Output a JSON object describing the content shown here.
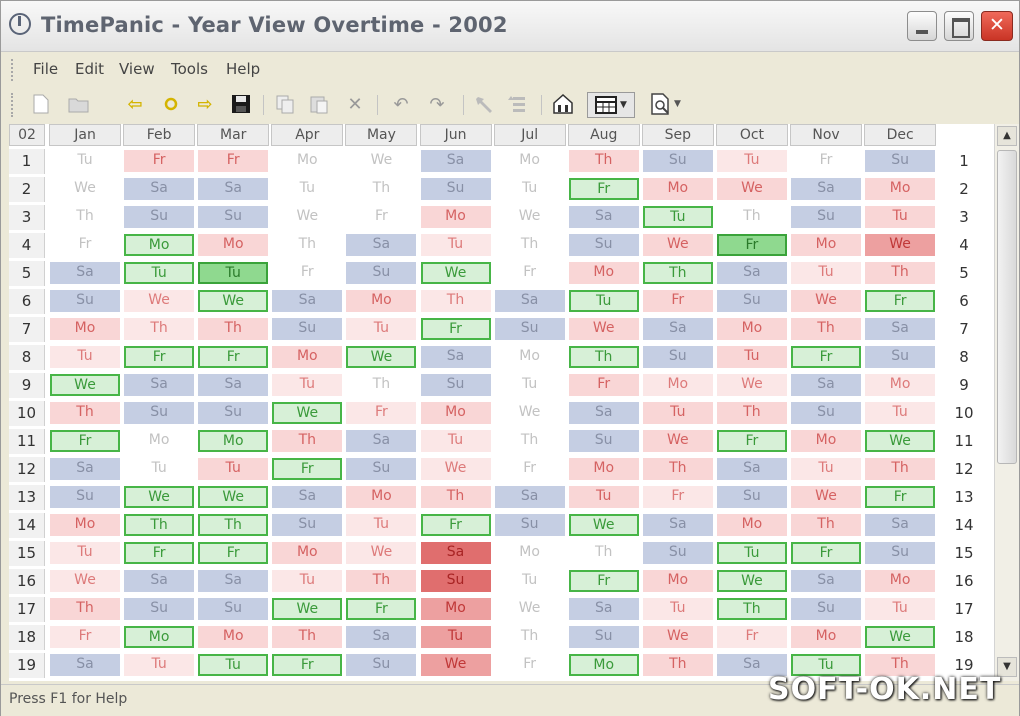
{
  "window": {
    "title": "TimePanic - Year View Overtime - 2002",
    "close_glyph": "✕",
    "icon": "clock-icon"
  },
  "menu": [
    "File",
    "Edit",
    "View",
    "Tools",
    "Help"
  ],
  "toolbar": {
    "icons": [
      "new-document-icon",
      "open-folder-icon",
      "back-arrow-icon",
      "circle-icon",
      "forward-arrow-icon",
      "save-icon",
      "copy-icon",
      "paste-icon",
      "delete-icon",
      "undo-icon",
      "redo-icon",
      "hammer-icon",
      "list-icon",
      "home-icon",
      "grid-view-icon",
      "print-preview-icon"
    ],
    "colors": {
      "arrow": "#d4b400",
      "save": "#1a1a1a"
    }
  },
  "grid": {
    "year_label": "02",
    "months": [
      "Jan",
      "Feb",
      "Mar",
      "Apr",
      "May",
      "Jun",
      "Jul",
      "Aug",
      "Sep",
      "Oct",
      "Nov",
      "Dec"
    ],
    "row_labels": [
      "1",
      "2",
      "3",
      "4",
      "5",
      "6",
      "7",
      "8",
      "9",
      "10",
      "11",
      "12",
      "13",
      "14",
      "15",
      "16",
      "17",
      "18",
      "19"
    ],
    "cells": [
      [
        [
          "Tu",
          "w"
        ],
        [
          "We",
          "w"
        ],
        [
          "Th",
          "w"
        ],
        [
          "Fr",
          "w"
        ],
        [
          "Sa",
          "b"
        ],
        [
          "Su",
          "b"
        ],
        [
          "Mo",
          "p"
        ],
        [
          "Tu",
          "lp"
        ],
        [
          "We",
          "g"
        ],
        [
          "Th",
          "p"
        ],
        [
          "Fr",
          "g"
        ],
        [
          "Sa",
          "b"
        ],
        [
          "Su",
          "b"
        ],
        [
          "Mo",
          "p"
        ],
        [
          "Tu",
          "lp"
        ],
        [
          "We",
          "lp"
        ],
        [
          "Th",
          "p"
        ],
        [
          "Fr",
          "lp"
        ],
        [
          "Sa",
          "b"
        ]
      ],
      [
        [
          "Fr",
          "p"
        ],
        [
          "Sa",
          "b"
        ],
        [
          "Su",
          "b"
        ],
        [
          "Mo",
          "g"
        ],
        [
          "Tu",
          "g"
        ],
        [
          "We",
          "lp"
        ],
        [
          "Th",
          "lp"
        ],
        [
          "Fr",
          "g"
        ],
        [
          "Sa",
          "b"
        ],
        [
          "Su",
          "b"
        ],
        [
          "Mo",
          "w"
        ],
        [
          "Tu",
          "w"
        ],
        [
          "We",
          "g"
        ],
        [
          "Th",
          "g"
        ],
        [
          "Fr",
          "g"
        ],
        [
          "Sa",
          "b"
        ],
        [
          "Su",
          "b"
        ],
        [
          "Mo",
          "g"
        ],
        [
          "Tu",
          "lp"
        ]
      ],
      [
        [
          "Fr",
          "p"
        ],
        [
          "Sa",
          "b"
        ],
        [
          "Su",
          "b"
        ],
        [
          "Mo",
          "p"
        ],
        [
          "Tu",
          "gf"
        ],
        [
          "We",
          "g"
        ],
        [
          "Th",
          "p"
        ],
        [
          "Fr",
          "g"
        ],
        [
          "Sa",
          "b"
        ],
        [
          "Su",
          "b"
        ],
        [
          "Mo",
          "g"
        ],
        [
          "Tu",
          "p"
        ],
        [
          "We",
          "g"
        ],
        [
          "Th",
          "g"
        ],
        [
          "Fr",
          "g"
        ],
        [
          "Sa",
          "b"
        ],
        [
          "Su",
          "b"
        ],
        [
          "Mo",
          "p"
        ],
        [
          "Tu",
          "g"
        ]
      ],
      [
        [
          "Mo",
          "w"
        ],
        [
          "Tu",
          "w"
        ],
        [
          "We",
          "w"
        ],
        [
          "Th",
          "w"
        ],
        [
          "Fr",
          "w"
        ],
        [
          "Sa",
          "b"
        ],
        [
          "Su",
          "b"
        ],
        [
          "Mo",
          "p"
        ],
        [
          "Tu",
          "lp"
        ],
        [
          "We",
          "g"
        ],
        [
          "Th",
          "p"
        ],
        [
          "Fr",
          "g"
        ],
        [
          "Sa",
          "b"
        ],
        [
          "Su",
          "b"
        ],
        [
          "Mo",
          "p"
        ],
        [
          "Tu",
          "lp"
        ],
        [
          "We",
          "g"
        ],
        [
          "Th",
          "p"
        ],
        [
          "Fr",
          "g"
        ]
      ],
      [
        [
          "We",
          "w"
        ],
        [
          "Th",
          "w"
        ],
        [
          "Fr",
          "w"
        ],
        [
          "Sa",
          "b"
        ],
        [
          "Su",
          "b"
        ],
        [
          "Mo",
          "p"
        ],
        [
          "Tu",
          "lp"
        ],
        [
          "We",
          "g"
        ],
        [
          "Th",
          "w"
        ],
        [
          "Fr",
          "lp"
        ],
        [
          "Sa",
          "b"
        ],
        [
          "Su",
          "b"
        ],
        [
          "Mo",
          "p"
        ],
        [
          "Tu",
          "lp"
        ],
        [
          "We",
          "lp"
        ],
        [
          "Th",
          "p"
        ],
        [
          "Fr",
          "g"
        ],
        [
          "Sa",
          "b"
        ],
        [
          "Su",
          "b"
        ]
      ],
      [
        [
          "Sa",
          "b"
        ],
        [
          "Su",
          "b"
        ],
        [
          "Mo",
          "p"
        ],
        [
          "Tu",
          "lp"
        ],
        [
          "We",
          "g"
        ],
        [
          "Th",
          "lp"
        ],
        [
          "Fr",
          "g"
        ],
        [
          "Sa",
          "b"
        ],
        [
          "Su",
          "b"
        ],
        [
          "Mo",
          "p"
        ],
        [
          "Tu",
          "lp"
        ],
        [
          "We",
          "lp"
        ],
        [
          "Th",
          "p"
        ],
        [
          "Fr",
          "g"
        ],
        [
          "Sa",
          "rr"
        ],
        [
          "Su",
          "rr"
        ],
        [
          "Mo",
          "r"
        ],
        [
          "Tu",
          "r"
        ],
        [
          "We",
          "r"
        ]
      ],
      [
        [
          "Mo",
          "w"
        ],
        [
          "Tu",
          "w"
        ],
        [
          "We",
          "w"
        ],
        [
          "Th",
          "w"
        ],
        [
          "Fr",
          "w"
        ],
        [
          "Sa",
          "b"
        ],
        [
          "Su",
          "b"
        ],
        [
          "Mo",
          "w"
        ],
        [
          "Tu",
          "w"
        ],
        [
          "We",
          "w"
        ],
        [
          "Th",
          "w"
        ],
        [
          "Fr",
          "w"
        ],
        [
          "Sa",
          "b"
        ],
        [
          "Su",
          "b"
        ],
        [
          "Mo",
          "w"
        ],
        [
          "Tu",
          "w"
        ],
        [
          "We",
          "w"
        ],
        [
          "Th",
          "w"
        ],
        [
          "Fr",
          "w"
        ]
      ],
      [
        [
          "Th",
          "p"
        ],
        [
          "Fr",
          "g"
        ],
        [
          "Sa",
          "b"
        ],
        [
          "Su",
          "b"
        ],
        [
          "Mo",
          "p"
        ],
        [
          "Tu",
          "g"
        ],
        [
          "We",
          "p"
        ],
        [
          "Th",
          "g"
        ],
        [
          "Fr",
          "p"
        ],
        [
          "Sa",
          "b"
        ],
        [
          "Su",
          "b"
        ],
        [
          "Mo",
          "p"
        ],
        [
          "Tu",
          "p"
        ],
        [
          "We",
          "g"
        ],
        [
          "Th",
          "w"
        ],
        [
          "Fr",
          "g"
        ],
        [
          "Sa",
          "b"
        ],
        [
          "Su",
          "b"
        ],
        [
          "Mo",
          "g"
        ]
      ],
      [
        [
          "Su",
          "b"
        ],
        [
          "Mo",
          "p"
        ],
        [
          "Tu",
          "g"
        ],
        [
          "We",
          "p"
        ],
        [
          "Th",
          "g"
        ],
        [
          "Fr",
          "p"
        ],
        [
          "Sa",
          "b"
        ],
        [
          "Su",
          "b"
        ],
        [
          "Mo",
          "lp"
        ],
        [
          "Tu",
          "p"
        ],
        [
          "We",
          "p"
        ],
        [
          "Th",
          "p"
        ],
        [
          "Fr",
          "lp"
        ],
        [
          "Sa",
          "b"
        ],
        [
          "Su",
          "b"
        ],
        [
          "Mo",
          "p"
        ],
        [
          "Tu",
          "lp"
        ],
        [
          "We",
          "p"
        ],
        [
          "Th",
          "p"
        ]
      ],
      [
        [
          "Tu",
          "lp"
        ],
        [
          "We",
          "p"
        ],
        [
          "Th",
          "w"
        ],
        [
          "Fr",
          "gf"
        ],
        [
          "Sa",
          "b"
        ],
        [
          "Su",
          "b"
        ],
        [
          "Mo",
          "p"
        ],
        [
          "Tu",
          "p"
        ],
        [
          "We",
          "lp"
        ],
        [
          "Th",
          "p"
        ],
        [
          "Fr",
          "g"
        ],
        [
          "Sa",
          "b"
        ],
        [
          "Su",
          "b"
        ],
        [
          "Mo",
          "p"
        ],
        [
          "Tu",
          "g"
        ],
        [
          "We",
          "g"
        ],
        [
          "Th",
          "g"
        ],
        [
          "Fr",
          "lp"
        ],
        [
          "Sa",
          "b"
        ]
      ],
      [
        [
          "Fr",
          "w"
        ],
        [
          "Sa",
          "b"
        ],
        [
          "Su",
          "b"
        ],
        [
          "Mo",
          "p"
        ],
        [
          "Tu",
          "lp"
        ],
        [
          "We",
          "p"
        ],
        [
          "Th",
          "p"
        ],
        [
          "Fr",
          "g"
        ],
        [
          "Sa",
          "b"
        ],
        [
          "Su",
          "b"
        ],
        [
          "Mo",
          "p"
        ],
        [
          "Tu",
          "lp"
        ],
        [
          "We",
          "p"
        ],
        [
          "Th",
          "p"
        ],
        [
          "Fr",
          "g"
        ],
        [
          "Sa",
          "b"
        ],
        [
          "Su",
          "b"
        ],
        [
          "Mo",
          "p"
        ],
        [
          "Tu",
          "g"
        ]
      ],
      [
        [
          "Su",
          "b"
        ],
        [
          "Mo",
          "p"
        ],
        [
          "Tu",
          "p"
        ],
        [
          "We",
          "r"
        ],
        [
          "Th",
          "p"
        ],
        [
          "Fr",
          "g"
        ],
        [
          "Sa",
          "b"
        ],
        [
          "Su",
          "b"
        ],
        [
          "Mo",
          "lp"
        ],
        [
          "Tu",
          "lp"
        ],
        [
          "We",
          "g"
        ],
        [
          "Th",
          "p"
        ],
        [
          "Fr",
          "g"
        ],
        [
          "Sa",
          "b"
        ],
        [
          "Su",
          "b"
        ],
        [
          "Mo",
          "p"
        ],
        [
          "Tu",
          "lp"
        ],
        [
          "We",
          "g"
        ],
        [
          "Th",
          "p"
        ]
      ]
    ]
  },
  "status": {
    "text": "Press F1 for Help"
  },
  "watermark": "SOFT-OK.NET"
}
